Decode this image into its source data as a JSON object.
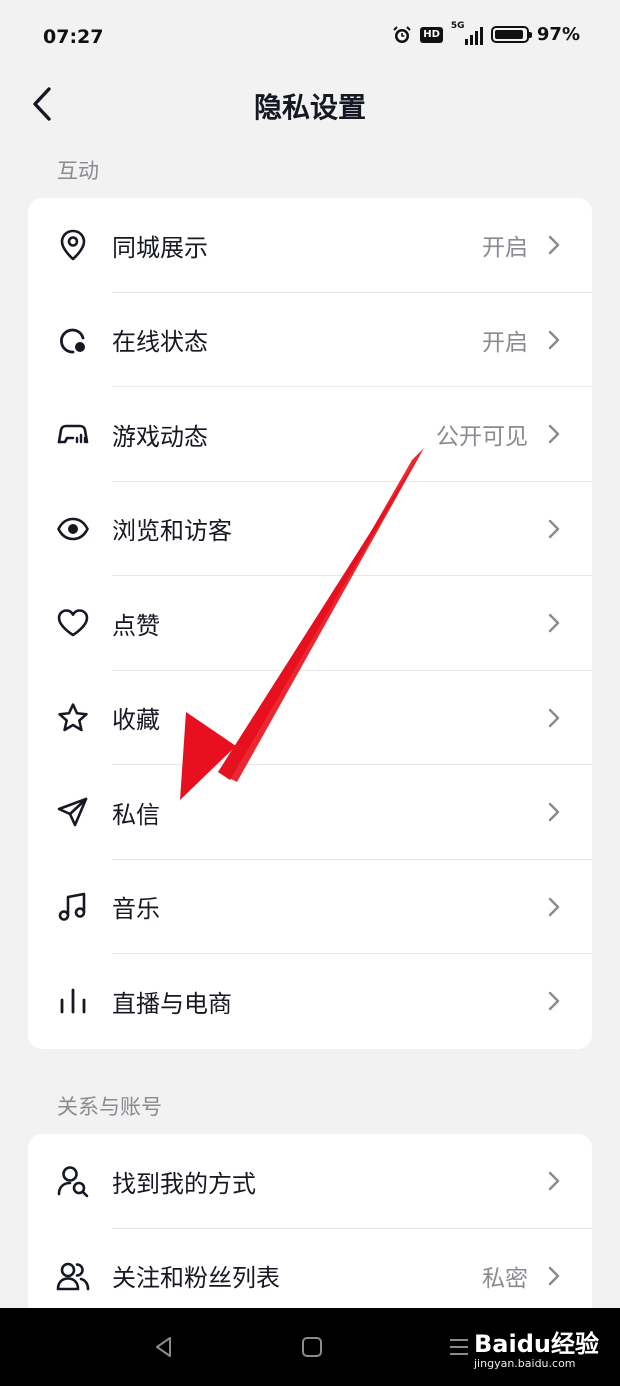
{
  "status": {
    "time": "07:27",
    "hd": "HD",
    "network": "5G",
    "battery": "97%"
  },
  "header": {
    "title": "隐私设置"
  },
  "sections": [
    {
      "title": "互动",
      "items": [
        {
          "label": "同城展示",
          "value": "开启",
          "icon": "location-pin-icon"
        },
        {
          "label": "在线状态",
          "value": "开启",
          "icon": "online-status-icon"
        },
        {
          "label": "游戏动态",
          "value": "公开可见",
          "icon": "game-controller-icon"
        },
        {
          "label": "浏览和访客",
          "value": "",
          "icon": "eye-icon"
        },
        {
          "label": "点赞",
          "value": "",
          "icon": "heart-icon"
        },
        {
          "label": "收藏",
          "value": "",
          "icon": "star-icon"
        },
        {
          "label": "私信",
          "value": "",
          "icon": "paper-plane-icon"
        },
        {
          "label": "音乐",
          "value": "",
          "icon": "music-note-icon"
        },
        {
          "label": "直播与电商",
          "value": "",
          "icon": "bar-chart-icon"
        }
      ]
    },
    {
      "title": "关系与账号",
      "items": [
        {
          "label": "找到我的方式",
          "value": "",
          "icon": "user-search-icon"
        },
        {
          "label": "关注和粉丝列表",
          "value": "私密",
          "icon": "users-icon"
        }
      ]
    }
  ],
  "watermark": {
    "brand": "Baidu经验",
    "url": "jingyan.baidu.com"
  },
  "colors": {
    "background": "#f2f2f2",
    "card": "#ffffff",
    "text": "#161823",
    "secondary": "#8a8b91",
    "arrow": "#e8101e"
  }
}
